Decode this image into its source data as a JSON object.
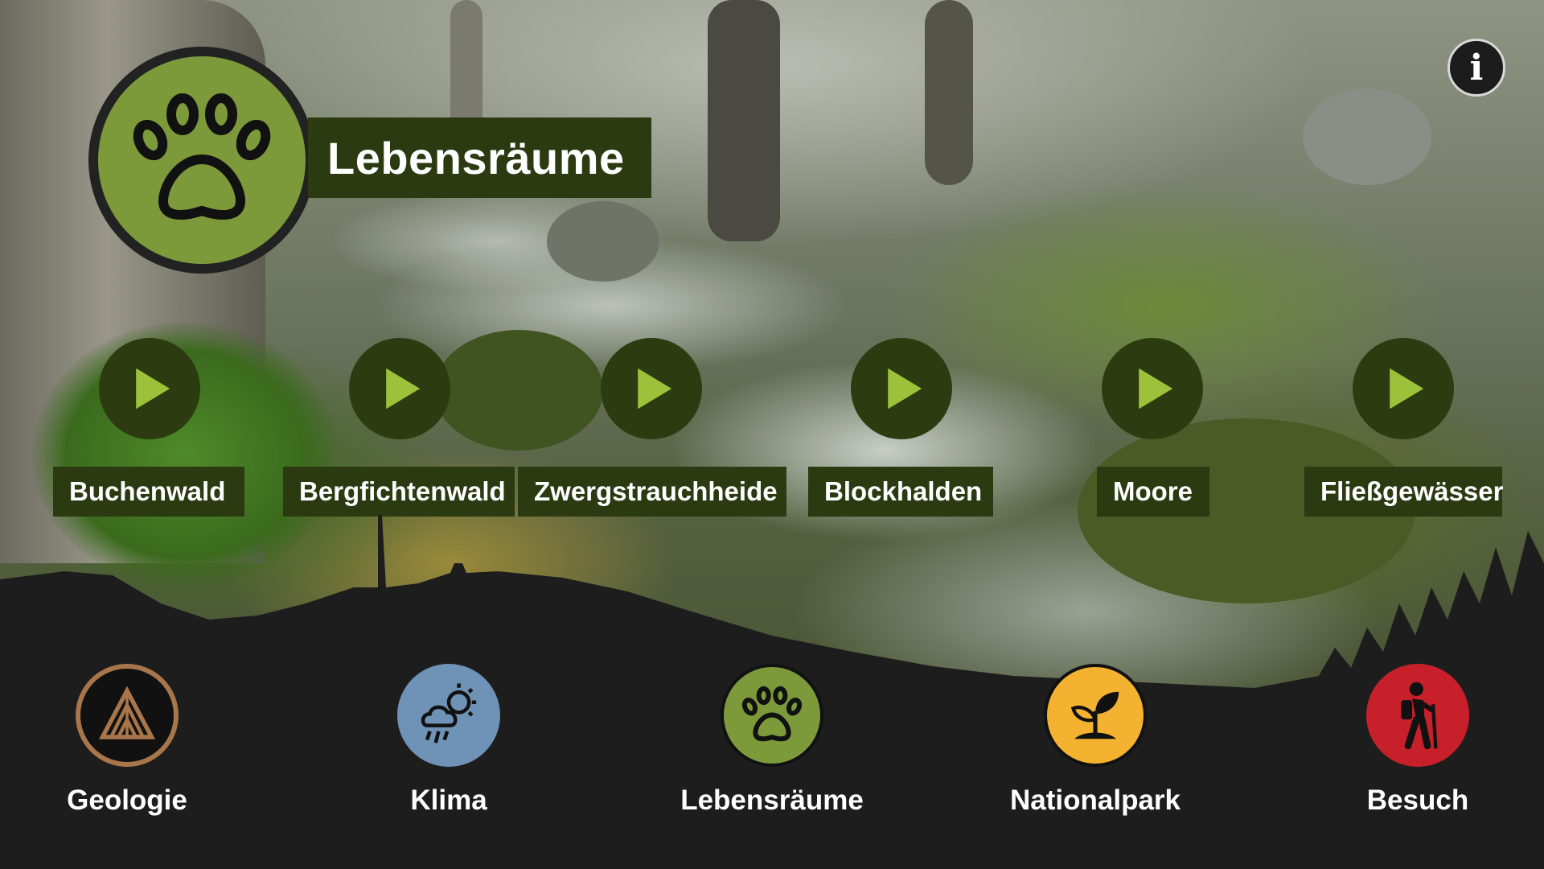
{
  "page": {
    "title": "Lebensräume",
    "info_label": "i"
  },
  "habitats": [
    {
      "label": "Buchenwald"
    },
    {
      "label": "Bergfichtenwald"
    },
    {
      "label": "Zwergstrauchheide"
    },
    {
      "label": "Blockhalden"
    },
    {
      "label": "Moore"
    },
    {
      "label": "Fließgewässer"
    }
  ],
  "nav": [
    {
      "label": "Geologie",
      "icon": "geology-icon",
      "color": "#a8764a"
    },
    {
      "label": "Klima",
      "icon": "weather-icon",
      "color": "#6e93b6"
    },
    {
      "label": "Lebensräume",
      "icon": "paw-icon",
      "color": "#7d9a3b"
    },
    {
      "label": "Nationalpark",
      "icon": "sprout-icon",
      "color": "#f3b22f"
    },
    {
      "label": "Besuch",
      "icon": "hiker-icon",
      "color": "#c8202a"
    }
  ],
  "colors": {
    "accent_green": "#7d9a3b",
    "label_bg": "#2c3a12",
    "play_icon": "#9cc13a",
    "nav_bg": "#1d1d1d"
  }
}
